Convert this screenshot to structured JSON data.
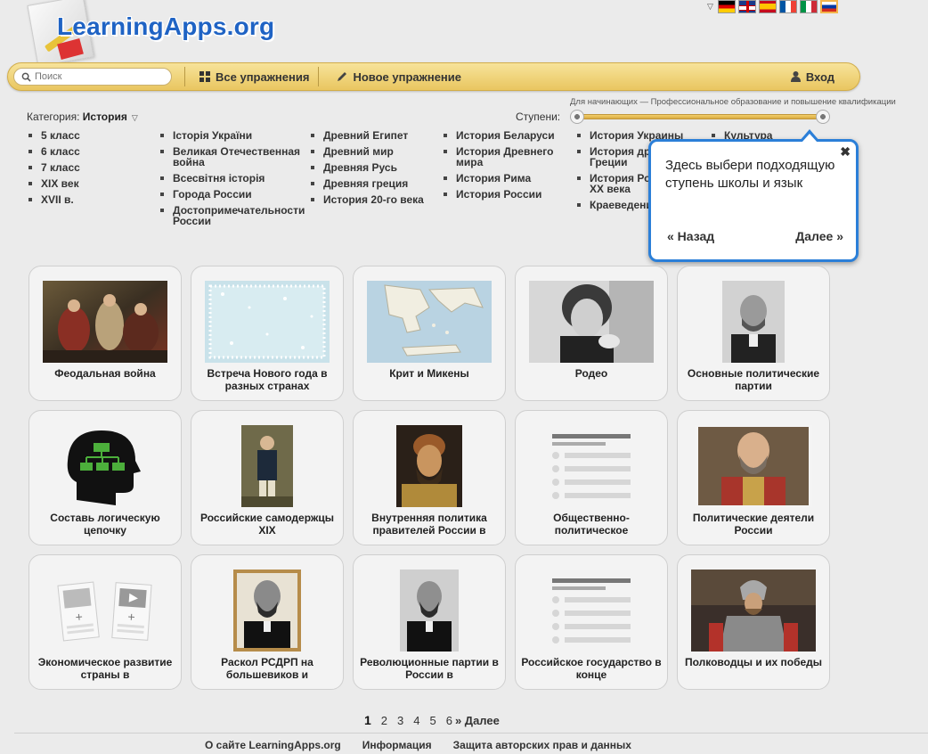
{
  "logo": {
    "text": "LearningApps.org"
  },
  "languages": [
    "de",
    "en",
    "es",
    "fr",
    "it",
    "ru"
  ],
  "nav": {
    "search_placeholder": "Поиск",
    "all_exercises": "Все упражнения",
    "new_exercise": "Новое упражнение",
    "login": "Вход"
  },
  "filters": {
    "levels_caption": "Для начинающих — Профессиональное образование и повышение квалификации",
    "category_prefix": "Категория:",
    "category_value": "История",
    "steps_label": "Ступени:"
  },
  "categories": [
    [
      "5 класс",
      "6 класс",
      "7 класс",
      "XIX век",
      "XVII в."
    ],
    [
      "Історія України",
      "Великая Отечественная война",
      "Всесвітня історія",
      "Города России",
      "Достопримечательности России"
    ],
    [
      "Древний Египет",
      "Древний мир",
      "Древняя Русь",
      "Древняя греция",
      "История 20-го века"
    ],
    [
      "История Беларуси",
      "История Древнего мира",
      "История Рима",
      "История России"
    ],
    [
      "История Украины",
      "История древней Греции",
      "История России XX века",
      "Краеведение"
    ],
    [
      "Культура"
    ]
  ],
  "tooltip": {
    "close": "✖",
    "text": "Здесь выбери подходящую ступень школы и язык",
    "back": "« Назад",
    "next": "Далее »"
  },
  "cards": [
    {
      "title": "Феодальная война",
      "thumb": "painting"
    },
    {
      "title": "Встреча Нового года в разных странах",
      "thumb": "snow"
    },
    {
      "title": "Крит и Микены",
      "thumb": "map"
    },
    {
      "title": "Родео",
      "thumb": "portrait-bw"
    },
    {
      "title": "Основные политические партии",
      "thumb": "portrait-bw-small"
    },
    {
      "title": "Составь логическую цепочку",
      "thumb": "head-icon"
    },
    {
      "title": "Российские самодержцы XIX",
      "thumb": "portrait-color-small"
    },
    {
      "title": "Внутренняя политика правителей России в",
      "thumb": "portrait-color"
    },
    {
      "title": "Общественно-политическое",
      "thumb": "list-icon"
    },
    {
      "title": "Политические деятели России",
      "thumb": "portrait-color-wide"
    },
    {
      "title": "Экономическое развитие страны в",
      "thumb": "media-icon"
    },
    {
      "title": "Раскол РСДРП на большевиков и",
      "thumb": "portrait-framed"
    },
    {
      "title": "Революционные партии в России в",
      "thumb": "portrait-bw-small"
    },
    {
      "title": "Российское государство в конце",
      "thumb": "list-icon"
    },
    {
      "title": "Полководцы и их победы",
      "thumb": "painting-knight"
    }
  ],
  "pagination": {
    "pages": [
      "1",
      "2",
      "3",
      "4",
      "5",
      "6"
    ],
    "next": "» Далее"
  },
  "footer": {
    "about": "О сайте LearningApps.org",
    "info": "Информация",
    "privacy": "Защита авторских прав и данных"
  }
}
